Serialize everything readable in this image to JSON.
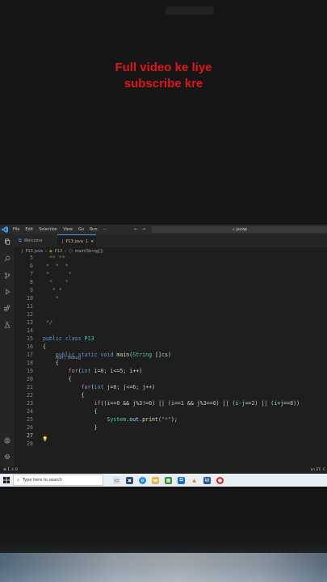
{
  "overlay": {
    "line1": "Full video ke liye",
    "line2": "subscribe kre",
    "color": "#e0161a"
  },
  "titlebar": {
    "menu": [
      "File",
      "Edit",
      "Selection",
      "View",
      "Go",
      "Run",
      "···"
    ],
    "search": "javap"
  },
  "tabs": [
    {
      "label": "Welcome",
      "active": false
    },
    {
      "label": "P13.java",
      "badge": "1",
      "close": "×",
      "active": true
    }
  ],
  "breadcrumb": {
    "file": "P13.java",
    "class": "P13",
    "method": "main(String[])"
  },
  "codelens": "Run | Debug",
  "code_lines": [
    {
      "n": "5",
      "text": "  ** **"
    },
    {
      "n": "6",
      "text": " *  *  *"
    },
    {
      "n": "7",
      "text": " *      *"
    },
    {
      "n": "8",
      "text": "  *    *"
    },
    {
      "n": "9",
      "text": "   * *"
    },
    {
      "n": "10",
      "text": "    *"
    },
    {
      "n": "11",
      "text": ""
    },
    {
      "n": "12",
      "text": ""
    },
    {
      "n": "13",
      "text": " */"
    },
    {
      "n": "14",
      "text": ""
    },
    {
      "n": "15",
      "text": "public class P13"
    },
    {
      "n": "16",
      "text": "{"
    },
    {
      "n": "17",
      "text": "    public static void main(String []cs)"
    },
    {
      "n": "18",
      "text": "    {"
    },
    {
      "n": "19",
      "text": "        for(int i=0; i<=5; i++)"
    },
    {
      "n": "20",
      "text": "        {"
    },
    {
      "n": "21",
      "text": "            for(int j=0; j<=6; j++)"
    },
    {
      "n": "22",
      "text": "            {"
    },
    {
      "n": "23",
      "text": "                if((i==0 && j%3!=0) || (i==1 && j%3==0) || (i-j==2) || (i+j==8))"
    },
    {
      "n": "24",
      "text": "                {"
    },
    {
      "n": "25",
      "text": "                    System.out.print(\"*\");"
    },
    {
      "n": "26",
      "text": "                }"
    },
    {
      "n": "27",
      "text": ""
    },
    {
      "n": "28",
      "text": ""
    }
  ],
  "current_line": "27",
  "statusbar": {
    "left": "⊗ 1 ⚠ 0",
    "right": "Ln 27, C"
  },
  "taskbar": {
    "search_placeholder": "Type here to search"
  },
  "colors": {
    "editor_bg": "#1e1e1e",
    "keyword": "#569cd6",
    "control": "#c586c0",
    "type": "#4ec9b0",
    "function": "#dcdcaa",
    "number": "#b5cea8",
    "string": "#ce9178"
  },
  "icons": [
    "vscode-logo-icon",
    "explorer-icon",
    "search-icon",
    "source-control-icon",
    "run-debug-icon",
    "extensions-icon",
    "testing-icon",
    "account-icon",
    "settings-icon",
    "windows-start-icon",
    "lightbulb-icon"
  ]
}
